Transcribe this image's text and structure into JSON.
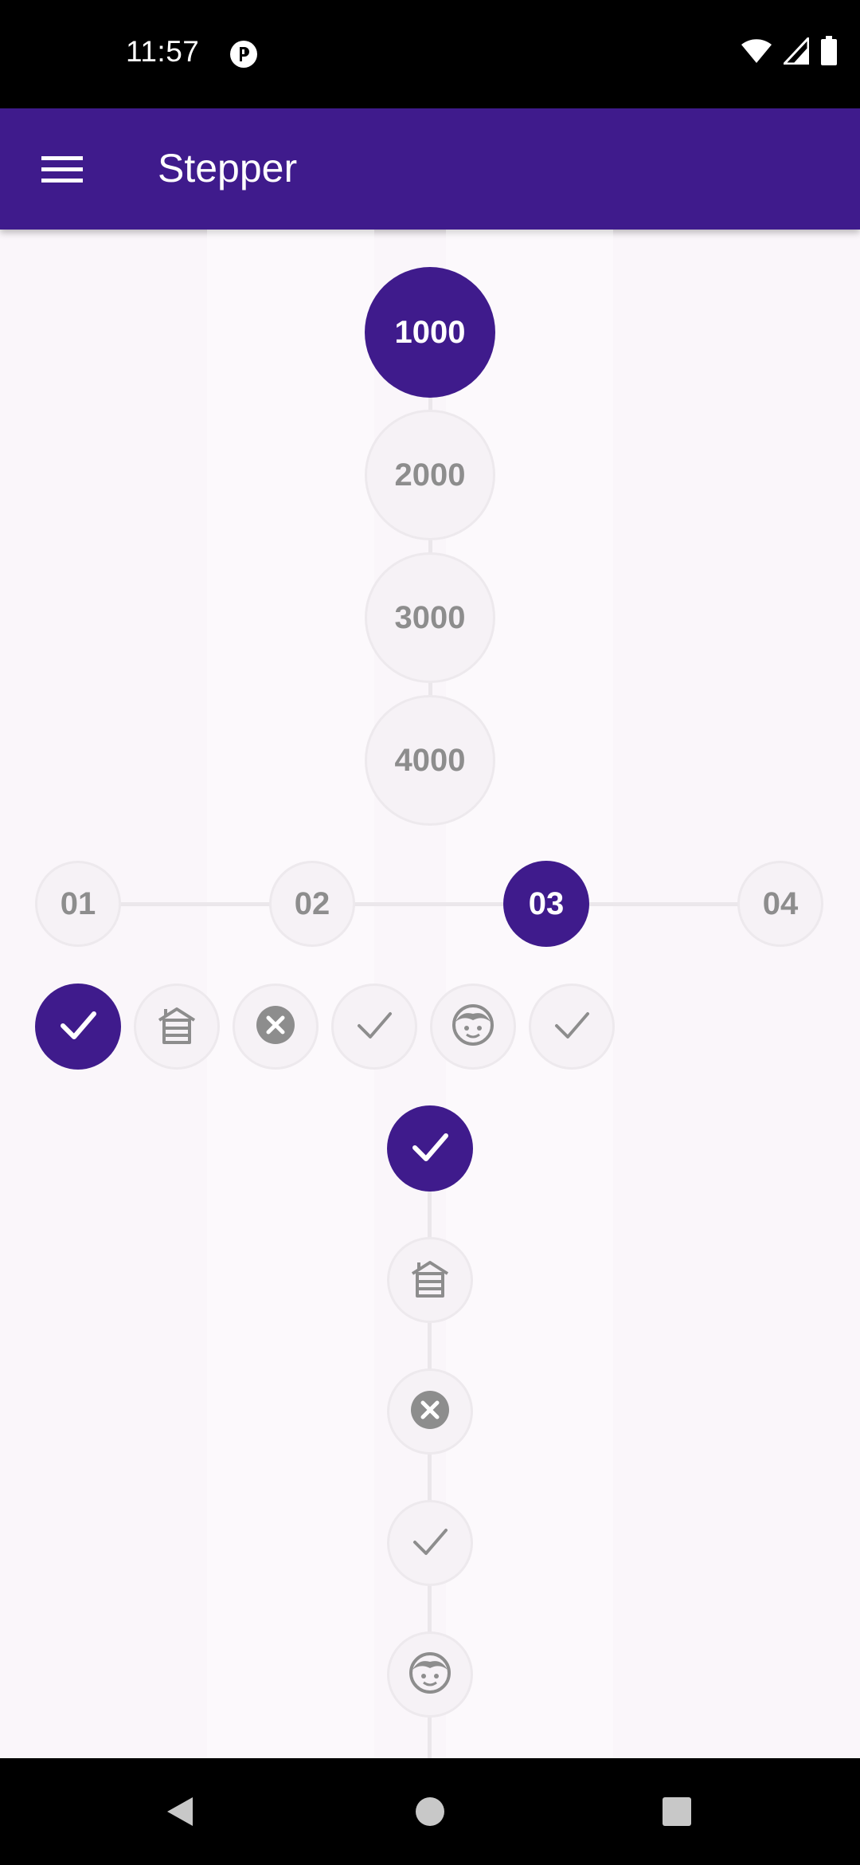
{
  "status_bar": {
    "time": "11:57",
    "icons": [
      "notification-badge-icon",
      "wifi-icon",
      "signal-icon",
      "battery-icon"
    ]
  },
  "app_bar": {
    "title": "Stepper",
    "menu_icon": "hamburger-menu-icon"
  },
  "vertical_number_stepper": {
    "steps": [
      "1000",
      "2000",
      "3000",
      "4000"
    ],
    "active_index": 0
  },
  "horizontal_number_stepper": {
    "steps": [
      "01",
      "02",
      "03",
      "04"
    ],
    "active_index": 2
  },
  "horizontal_icon_stepper": {
    "steps": [
      "check-icon",
      "building-icon",
      "close-circle-icon",
      "check-icon",
      "face-icon",
      "check-icon"
    ],
    "active_index": 0
  },
  "vertical_icon_stepper": {
    "steps": [
      "check-icon",
      "building-icon",
      "close-circle-icon",
      "check-icon",
      "face-icon"
    ],
    "active_index": 0
  },
  "colors": {
    "primary": "#3f1b8c",
    "background": "#faf6fa",
    "inactive_text": "#8d8d8d",
    "connector": "#ebe7eb"
  },
  "nav_bar": {
    "buttons": [
      "back-icon",
      "home-icon",
      "recents-icon"
    ]
  }
}
